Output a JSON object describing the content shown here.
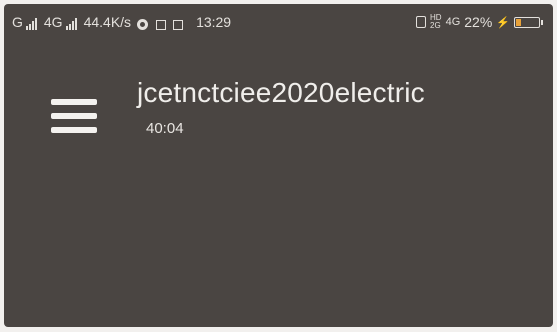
{
  "status_bar": {
    "carrier1": "G",
    "carrier2": "4G",
    "net_speed": "44.4K/s",
    "time": "13:29",
    "hd_top": "HD",
    "hd_bottom": "2G",
    "net_label": "4G",
    "battery_percent": "22%",
    "battery_level": 0.22,
    "battery_color": "#e8a23a"
  },
  "app_bar": {
    "title": "jcetnctciee2020electric",
    "subtitle": "40:04"
  },
  "colors": {
    "background": "#4a4542",
    "text": "#f0eeeb"
  }
}
